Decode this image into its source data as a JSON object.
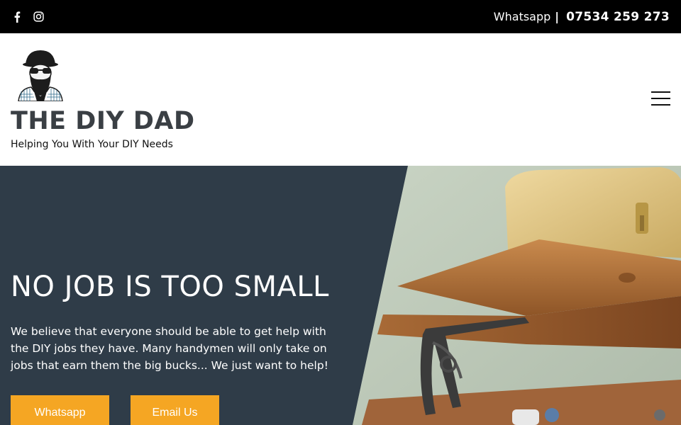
{
  "topbar": {
    "social_icons": [
      "facebook-icon",
      "instagram-icon"
    ],
    "whatsapp_label": "Whatsapp",
    "separator": "|",
    "phone": "07534 259 273"
  },
  "header": {
    "logo_icon": "bearded-dad-logo",
    "site_title": "THE DIY DAD",
    "tagline": "Helping You With Your DIY Needs",
    "menu_icon": "hamburger-menu-icon"
  },
  "hero": {
    "title": "NO JOB IS TOO SMALL",
    "text": "We believe that everyone should be able to get help with the DIY jobs they have. Many handymen will only take on jobs that earn them the big bucks... We just want to help!",
    "buttons": {
      "whatsapp": "Whatsapp",
      "email": "Email Us"
    }
  },
  "colors": {
    "topbar_bg": "#000000",
    "hero_bg": "#2f3c48",
    "accent": "#f5a623",
    "title_text": "#3a3f44"
  }
}
